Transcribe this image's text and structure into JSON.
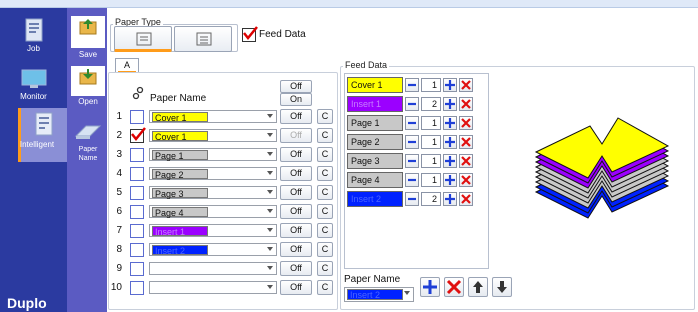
{
  "nav": {
    "items": [
      {
        "label": "Job",
        "icon": "job-icon"
      },
      {
        "label": "Monitor",
        "icon": "monitor-icon"
      },
      {
        "label": "Intelligent",
        "icon": "intelligent-icon"
      }
    ],
    "actions": [
      {
        "label": "Save",
        "icon": "save-icon"
      },
      {
        "label": "Open",
        "icon": "open-icon"
      },
      {
        "label": "Paper Name",
        "icon": "paper-name-icon"
      }
    ],
    "brand": "Duplo"
  },
  "paper_type": {
    "title": "Paper Type",
    "feed_data_label": "Feed Data",
    "feed_data_checked": true
  },
  "table": {
    "tab": "A",
    "header": {
      "paper_name": "Paper Name",
      "off": "Off",
      "on": "On"
    },
    "rows": [
      {
        "num": "1",
        "checked": false,
        "name": "Cover 1",
        "color": "#ffff00",
        "off": "Off",
        "c": "C",
        "dim": false
      },
      {
        "num": "2",
        "checked": true,
        "name": "Cover 1",
        "color": "#ffff00",
        "off": "Off",
        "c": "C",
        "dim": true
      },
      {
        "num": "3",
        "checked": false,
        "name": "Page 1",
        "color": "#c8c8c8",
        "off": "Off",
        "c": "C",
        "dim": false
      },
      {
        "num": "4",
        "checked": false,
        "name": "Page 2",
        "color": "#c8c8c8",
        "off": "Off",
        "c": "C",
        "dim": false
      },
      {
        "num": "5",
        "checked": false,
        "name": "Page 3",
        "color": "#c8c8c8",
        "off": "Off",
        "c": "C",
        "dim": false
      },
      {
        "num": "6",
        "checked": false,
        "name": "Page 4",
        "color": "#c8c8c8",
        "off": "Off",
        "c": "C",
        "dim": false
      },
      {
        "num": "7",
        "checked": false,
        "name": "Insert 1",
        "color": "#9b00ff",
        "off": "Off",
        "c": "C",
        "dim": false
      },
      {
        "num": "8",
        "checked": false,
        "name": "Insert 2",
        "color": "#0022ff",
        "off": "Off",
        "c": "C",
        "dim": false
      },
      {
        "num": "9",
        "checked": false,
        "name": "",
        "color": "#ffffff",
        "off": "Off",
        "c": "C",
        "dim": false
      },
      {
        "num": "10",
        "checked": false,
        "name": "",
        "color": "#ffffff",
        "off": "Off",
        "c": "C",
        "dim": false
      }
    ]
  },
  "feed_data": {
    "title": "Feed Data",
    "items": [
      {
        "name": "Cover 1",
        "color": "#ffff00",
        "qty": "1"
      },
      {
        "name": "Insert 1",
        "color": "#9b00ff",
        "qty": "2"
      },
      {
        "name": "Page 1",
        "color": "#c8c8c8",
        "qty": "1"
      },
      {
        "name": "Page 2",
        "color": "#c8c8c8",
        "qty": "1"
      },
      {
        "name": "Page 3",
        "color": "#c8c8c8",
        "qty": "1"
      },
      {
        "name": "Page 4",
        "color": "#c8c8c8",
        "qty": "1"
      },
      {
        "name": "Insert 2",
        "color": "#0022ff",
        "qty": "2"
      }
    ],
    "paper_name_label": "Paper Name",
    "paper_name_value": "Insert 2",
    "paper_name_color": "#0022ff"
  }
}
